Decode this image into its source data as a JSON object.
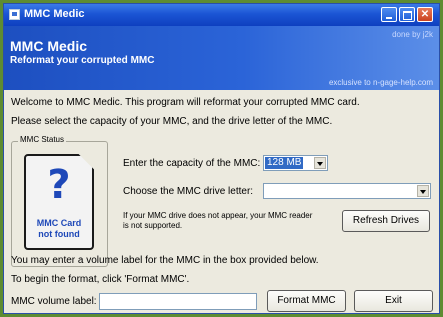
{
  "window": {
    "title": "MMC Medic",
    "minimize_icon": "minimize-icon",
    "maximize_icon": "maximize-icon",
    "close_glyph": "✕"
  },
  "banner": {
    "credit": "done by j2k",
    "app_name": "MMC Medic",
    "tagline": "Reformat your corrupted MMC",
    "exclusive": "exclusive to n-gage-help.com"
  },
  "intro": {
    "line1": "Welcome to MMC Medic. This program will reformat your corrupted MMC card.",
    "line2": "Please select the capacity of your MMC, and the drive letter of the MMC."
  },
  "status_box": {
    "legend": "MMC Status",
    "icon_glyph": "?",
    "status_line1": "MMC Card",
    "status_line2": "not found"
  },
  "capacity": {
    "label": "Enter the capacity of the MMC:",
    "selected": "128 MB"
  },
  "drive": {
    "label": "Choose the MMC drive letter:",
    "selected": ""
  },
  "note": {
    "line1": "If your MMC drive does not appear, your MMC reader",
    "line2": "is not supported."
  },
  "buttons": {
    "refresh": "Refresh Drives",
    "format": "Format MMC",
    "exit": "Exit"
  },
  "footer": {
    "line1": "You may enter a volume label for the MMC in the box provided below.",
    "line2": "To begin the format, click 'Format MMC'."
  },
  "volume": {
    "label": "MMC volume label:",
    "value": ""
  }
}
